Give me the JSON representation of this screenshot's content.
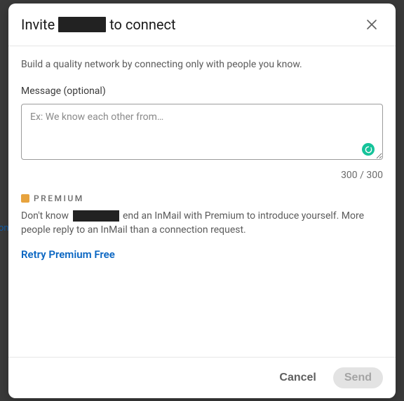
{
  "header": {
    "title_prefix": "Invite",
    "title_suffix": "to connect"
  },
  "body": {
    "subhead": "Build a quality network by connecting only with people you know.",
    "message_label": "Message (optional)",
    "message_placeholder": "Ex: We know each other from…",
    "counter": "300 / 300"
  },
  "premium": {
    "label": "PREMIUM",
    "desc_prefix": "Don't know",
    "desc_suffix": "end an InMail with Premium to introduce yourself. More people reply to an InMail than a connection request.",
    "retry_link": "Retry Premium Free"
  },
  "footer": {
    "cancel": "Cancel",
    "send": "Send"
  }
}
